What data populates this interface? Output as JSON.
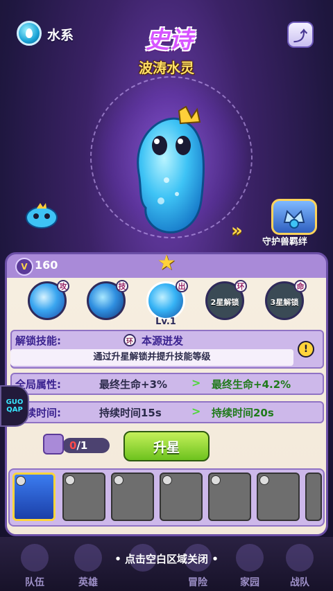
{
  "header": {
    "element_label": "水系",
    "rarity_label": "史诗",
    "pet_name": "波涛水灵"
  },
  "bond": {
    "label": "守护兽羁绊"
  },
  "panel": {
    "power": "160",
    "skills": [
      {
        "tag": "攻",
        "lock_text": ""
      },
      {
        "tag": "技",
        "lock_text": ""
      },
      {
        "tag": "出",
        "lock_text": ""
      },
      {
        "tag": "环",
        "lock_text": "2星解锁"
      },
      {
        "tag": "命",
        "lock_text": "3星解锁"
      }
    ],
    "skill_level": "Lv.1",
    "unlock": {
      "label": "解锁技能:",
      "tag": "环",
      "name": "本源迸发",
      "desc": "通过升星解锁并提升技能等级",
      "info": "!"
    },
    "stats": [
      {
        "label": "全局属性:",
        "current": "最终生命+3%",
        "next": "最终生命+4.2%"
      },
      {
        "label": "持续时间:",
        "current": "持续时间15s",
        "next": "持续时间20s"
      }
    ],
    "fragments": {
      "have": "0",
      "need": "/1"
    },
    "upgrade_label": "升星"
  },
  "side_logo": "GUO QAP",
  "close_hint": "• 点击空白区域关闭 •",
  "nav": [
    "队伍",
    "英雄",
    "",
    "冒险",
    "家园",
    "战队"
  ],
  "colors": {
    "accent_purple": "#6b4fa6",
    "upgrade_green": "#6dc21e",
    "next_value_green": "#1f7a1a",
    "fragment_red": "#ff4a4a",
    "gold": "#ffd53a"
  }
}
